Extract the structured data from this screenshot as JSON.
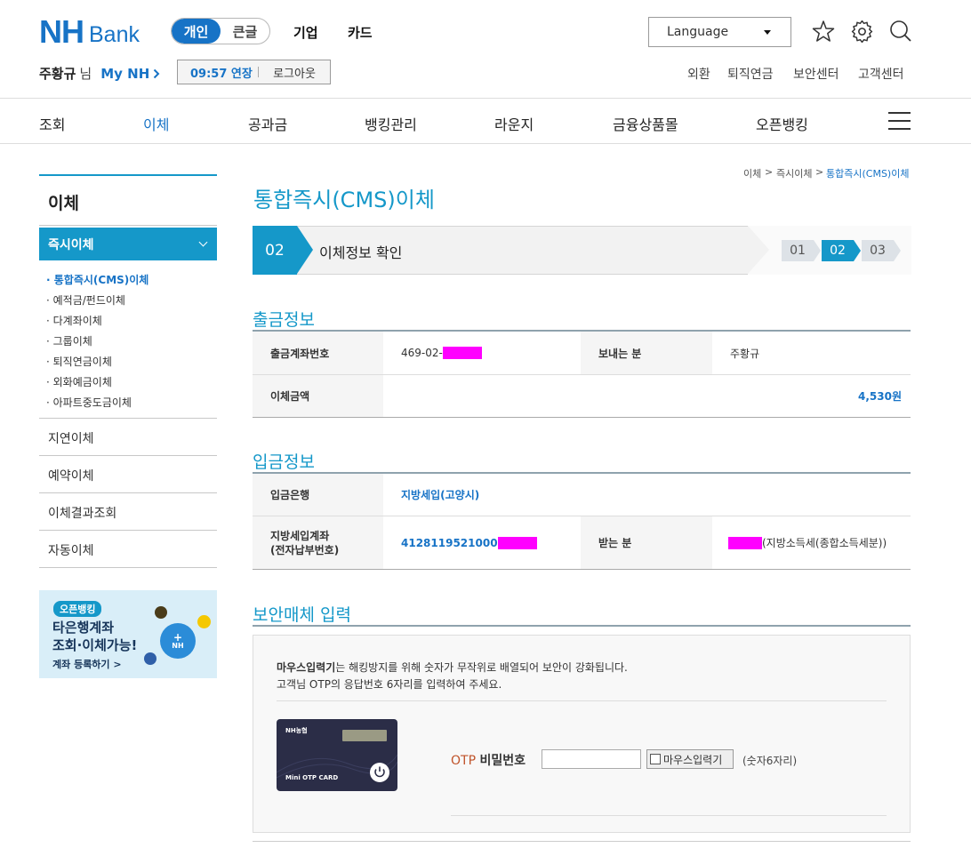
{
  "header": {
    "logo_main": "NH",
    "logo_sub": "Bank",
    "segment": {
      "active": "개인",
      "inactive": "큰글"
    },
    "top_links": [
      "기업",
      "카드"
    ],
    "language": "Language",
    "user_name": "주황규",
    "user_suffix": "님",
    "my_nh": "My NH",
    "timer": "09:57 연장",
    "logout": "로그아웃",
    "util_links": [
      "외환",
      "퇴직연금",
      "보안센터",
      "고객센터"
    ]
  },
  "gnb": [
    "조회",
    "이체",
    "공과금",
    "뱅킹관리",
    "라운지",
    "금융상품몰",
    "오픈뱅킹"
  ],
  "sidebar": {
    "title": "이체",
    "active_section": "즉시이체",
    "sub_items": [
      "· 통합즉시(CMS)이체",
      "· 예적금/펀드이체",
      "· 다계좌이체",
      "· 그룹이체",
      "· 퇴직연금이체",
      "· 외화예금이체",
      "· 아파트중도금이체"
    ],
    "menu_items": [
      "지연이체",
      "예약이체",
      "이체결과조회",
      "자동이체"
    ],
    "promo": {
      "badge": "오픈뱅킹",
      "line1": "타은행계좌",
      "line2": "조회·이체가능!",
      "link": "계좌 등록하기 >",
      "fab": "NH"
    }
  },
  "breadcrumb": [
    "이체",
    "즉시이체",
    "통합즉시(CMS)이체"
  ],
  "page_title": "통합즉시(CMS)이체",
  "step": {
    "current_num": "02",
    "label": "이체정보 확인",
    "steps": [
      "01",
      "02",
      "03"
    ]
  },
  "withdrawal": {
    "title": "출금정보",
    "account_label": "출금계좌번호",
    "account_value": "469-02-",
    "sender_label": "보내는 분",
    "sender_value": "주황규",
    "amount_label": "이체금액",
    "amount_value": "4,530원"
  },
  "deposit": {
    "title": "입금정보",
    "bank_label": "입금은행",
    "bank_value": "지방세입(고양시)",
    "account_label_1": "지방세입계좌",
    "account_label_2": "(전자납부번호)",
    "account_value": "4128119521000",
    "receiver_label": "받는 분",
    "receiver_value": "(지방소득세(종합소득세분))"
  },
  "security": {
    "title": "보안매체 입력",
    "desc1_bold": "마우스입력기",
    "desc1": "는 해킹방지를 위해 숫자가 무작위로 배열되어 보안이 강화됩니다.",
    "desc2": "고객님 OTP의 응답번호 6자리를 입력하여 주세요.",
    "card_brand": "NH농협",
    "card_label": "Mini OTP CARD",
    "otp_label_a": "OTP",
    "otp_label_b": "비밀번호",
    "mouse_label": "마우스입력기",
    "hint": "(숫자6자리)"
  },
  "colors": {
    "brand": "#1773c6",
    "accent": "#1598c9",
    "mask": "#ff00ff"
  }
}
